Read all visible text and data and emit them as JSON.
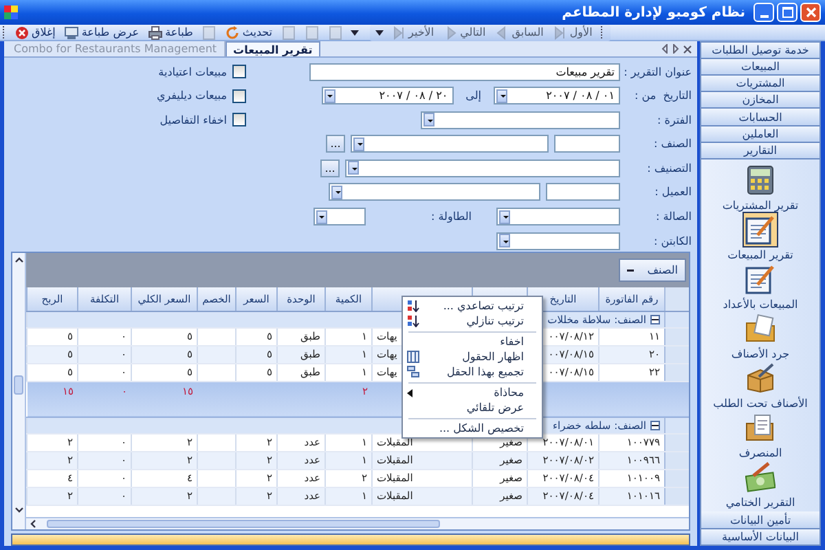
{
  "window": {
    "title": "نظام كومبو لإدارة المطاعم"
  },
  "toolbar": {
    "buttons": [
      {
        "kind": "blank",
        "disabled": true
      },
      {
        "kind": "blank",
        "disabled": true
      },
      {
        "kind": "blank",
        "disabled": true
      },
      {
        "kind": "refresh",
        "label": "تحديث",
        "disabled": false
      },
      {
        "kind": "blank",
        "disabled": true
      },
      {
        "kind": "print",
        "label": "طباعة",
        "disabled": false
      },
      {
        "kind": "preview",
        "label": "عرض طباعة",
        "disabled": false
      },
      {
        "kind": "close",
        "label": "إغلاق",
        "disabled": false
      }
    ]
  },
  "nav_toolbar": {
    "buttons": [
      {
        "kind": "first",
        "label": "الأول",
        "disabled": true
      },
      {
        "kind": "previous",
        "label": "السابق",
        "disabled": true
      },
      {
        "kind": "next",
        "label": "التالي",
        "disabled": true
      },
      {
        "kind": "last",
        "label": "الأخير",
        "disabled": true
      }
    ]
  },
  "tabs": [
    {
      "label": "تقرير المبيعات",
      "selected": true
    },
    {
      "label": "Combo for Restaurants Management",
      "selected": false
    }
  ],
  "form": {
    "rows": [
      {
        "kind": "text",
        "label": "عنوان التقرير :",
        "value": "تقرير مبيعات"
      },
      {
        "kind": "date-range",
        "label": "التاريخ  من :",
        "from": "٠١ / ٠٨ / ٢٠٠٧",
        "to_label": "إلى",
        "to": "٢٠ / ٠٨ / ٢٠٠٧"
      },
      {
        "kind": "wide-combo",
        "label": "الفترة :"
      },
      {
        "kind": "code-lookup",
        "label": "الصنف :",
        "browse_label": "..."
      },
      {
        "kind": "lookup",
        "label": "التصنيف :",
        "browse_label": "..."
      },
      {
        "kind": "code-combo",
        "label": "العميل :"
      },
      {
        "kind": "hall",
        "label": "الصالة :",
        "label2": "الطاولة :"
      },
      {
        "kind": "combo",
        "label": "الكابتن :"
      }
    ],
    "checkboxes": [
      {
        "label": "مبيعات اعتيادية",
        "checked": false
      },
      {
        "label": "مبيعات ديليفري",
        "checked": false
      },
      {
        "label": "اخفاء التفاصيل",
        "checked": false
      }
    ]
  },
  "grid": {
    "group_panel": {
      "label": "الصنف"
    },
    "columns": [
      {
        "label": "رقم الفاتورة"
      },
      {
        "label": "التاريخ"
      },
      {},
      {},
      {
        "label": "الكمية"
      },
      {
        "label": "الوحدة"
      },
      {
        "label": "السعر"
      },
      {
        "label": "الخصم"
      },
      {
        "label": "السعر الكلي"
      },
      {
        "label": "التكلفة"
      },
      {
        "label": "الربح"
      }
    ],
    "groups": [
      {
        "title": "الصنف: سلاطة مخللات",
        "expanded": true,
        "rows": [
          {
            "cells": [
              "١١",
              "٠٠٧/٠٨/١٢",
              null,
              "يهات",
              "١",
              "طبق",
              "٥",
              null,
              "٥",
              "٠",
              "٥"
            ]
          },
          {
            "cells": [
              "٢٠",
              "٠٠٧/٠٨/١٥",
              null,
              "يهات",
              "١",
              "طبق",
              "٥",
              null,
              "٥",
              "٠",
              "٥"
            ]
          },
          {
            "cells": [
              "٢٢",
              "٠٠٧/٠٨/١٥",
              null,
              "يهات",
              "١",
              "طبق",
              "٥",
              null,
              "٥",
              "٠",
              "٥"
            ]
          }
        ],
        "summary": {
          "cells": [
            null,
            null,
            null,
            null,
            "٢",
            null,
            null,
            null,
            "١٥",
            "٠",
            "١٥"
          ]
        }
      },
      {
        "title": "الصنف: سلطه خضراء",
        "expanded": true,
        "rows": [
          {
            "cells": [
              "١٠٠٧٧٩",
              "٢٠٠٧/٠٨/٠١",
              "صغير",
              "المقبلات",
              "١",
              "عدد",
              "٢",
              null,
              "٢",
              "٠",
              "٢"
            ]
          },
          {
            "cells": [
              "١٠٠٩٦٦",
              "٢٠٠٧/٠٨/٠٢",
              "صغير",
              "المقبلات",
              "١",
              "عدد",
              "٢",
              null,
              "٢",
              "٠",
              "٢"
            ]
          },
          {
            "cells": [
              "١٠١٠٠٩",
              "٢٠٠٧/٠٨/٠٤",
              "صغير",
              "المقبلات",
              "٢",
              "عدد",
              "٢",
              null,
              "٤",
              "٠",
              "٤"
            ]
          },
          {
            "cells": [
              "١٠١٠١٦",
              "٢٠٠٧/٠٨/٠٤",
              "صغير",
              "المقبلات",
              "١",
              "عدد",
              "٢",
              null,
              "٢",
              "٠",
              "٢"
            ]
          }
        ]
      }
    ]
  },
  "context_menu": {
    "items": [
      {
        "kind": "sort-asc",
        "label": "ترتيب تصاعدي ..."
      },
      {
        "kind": "sort-desc",
        "label": "ترتيب تنازلي"
      },
      {
        "kind": "separator"
      },
      {
        "kind": "plain",
        "label": "اخفاء"
      },
      {
        "kind": "columns",
        "label": "اظهار الحقول"
      },
      {
        "kind": "group",
        "label": "تجميع بهذا الحقل"
      },
      {
        "kind": "separator"
      },
      {
        "kind": "submenu",
        "label": "محاذاة"
      },
      {
        "kind": "plain",
        "label": "عرض تلقائي"
      },
      {
        "kind": "separator"
      },
      {
        "kind": "plain",
        "label": "تخصيص الشكل ..."
      }
    ]
  },
  "sidebar": {
    "header": "خدمة توصيل الطلبات",
    "sections": [
      "المبيعات",
      "المشتريات",
      "المخازن",
      "الحسابات",
      "العاملين",
      "التقارير"
    ],
    "items": [
      {
        "kind": "calculator",
        "label": "تقرير المشتريات",
        "selected": false
      },
      {
        "kind": "notepad",
        "label": "تقرير المبيعات",
        "selected": true
      },
      {
        "kind": "notepad",
        "label": "المبيعات بالأعداد",
        "selected": false
      },
      {
        "kind": "folder",
        "label": "جرد الأصناف",
        "selected": false
      },
      {
        "kind": "box",
        "label": "الأصناف تحت الطلب",
        "selected": false
      },
      {
        "kind": "document",
        "label": "المنصرف",
        "selected": false
      },
      {
        "kind": "cash",
        "label": "التقرير الختامي",
        "selected": false
      }
    ],
    "footer_sections": [
      "تأمين البيانات",
      "البيانات الأساسية"
    ]
  }
}
